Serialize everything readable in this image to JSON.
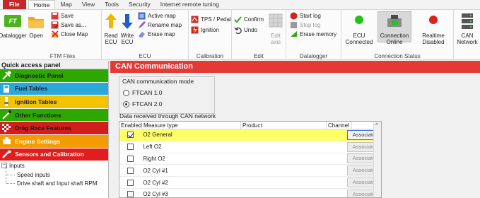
{
  "menu": {
    "tabs": [
      "File",
      "Home",
      "Map",
      "View",
      "Tools",
      "Security",
      "Internet remote tuning"
    ],
    "active": "Home"
  },
  "ribbon": {
    "groups": {
      "ftm_files": "FTM Files",
      "ecu": "ECU",
      "calibration": "Calibration",
      "edit": "Edit",
      "datalogger": "Datalogger",
      "connection_status": "Connection Status"
    },
    "datalogger": "Datalogger",
    "open": "Open",
    "save": "Save",
    "save_as": "Save as...",
    "close_map": "Close Map",
    "read_ecu": [
      "Read",
      "ECU"
    ],
    "write_ecu": [
      "Write",
      "ECU"
    ],
    "active_map": "Active map",
    "rename_map": "Rename map",
    "erase_map": "Erase map",
    "tps_pedal": "TPS / Pedal",
    "ignition": "Ignition",
    "confirm": "Confirm",
    "undo": "Undo",
    "edit_axis": [
      "Edit",
      "axis"
    ],
    "start_log": "Start log",
    "stop_log": "Stop log",
    "erase_memory": "Erase memory",
    "ecu_connected": [
      "ECU",
      "Connected"
    ],
    "connection_online": [
      "Connection",
      "Online"
    ],
    "realtime_disabled": [
      "Realtime",
      "Disabled"
    ],
    "can_network": [
      "CAN",
      "Network"
    ],
    "status_colors": {
      "ecu": "#22c41a",
      "connection": "#22c41a",
      "realtime": "#e02020"
    }
  },
  "quick_access": {
    "title": "Quick access panel",
    "panels": [
      {
        "label": "Diagnostic Panel",
        "color": "#2ea800",
        "icon": "diagnostic-icon"
      },
      {
        "label": "Fuel Tables",
        "color": "#29a8d9",
        "icon": "fuel-icon"
      },
      {
        "label": "Ignition Tables",
        "color": "#f3c300",
        "icon": "ignition-icon"
      },
      {
        "label": "Other Functions",
        "color": "#2ea800",
        "icon": "functions-icon"
      },
      {
        "label": "Drag Race Features",
        "color": "#d21d1d",
        "icon": "drag-race-icon"
      },
      {
        "label": "Engine Settings",
        "color": "#f39c00",
        "icon": "engine-icon"
      },
      {
        "label": "Sensors and Calibration",
        "color": "#e11d1d",
        "icon": "sensor-icon"
      }
    ],
    "tree": {
      "root": "Inputs",
      "children": [
        "Speed inputs",
        "Drive shaft and Input shaft RPM"
      ]
    }
  },
  "main": {
    "title": "CAN Communication",
    "mode": {
      "title": "CAN communication mode",
      "options": [
        "FTCAN 1.0",
        "FTCAN 2.0"
      ],
      "selected": "FTCAN 2.0"
    },
    "received": {
      "title": "Data received through CAN network",
      "columns": [
        "Enabled",
        "Measure type",
        "Product",
        "Channel"
      ],
      "rows": [
        {
          "enabled": true,
          "measure": "O2 General",
          "product": "",
          "channel": "",
          "action": "Associate"
        },
        {
          "enabled": false,
          "measure": "Left O2",
          "product": "",
          "channel": "",
          "action": "Associate"
        },
        {
          "enabled": false,
          "measure": "Right O2",
          "product": "",
          "channel": "",
          "action": "Associate"
        },
        {
          "enabled": false,
          "measure": "O2 Cyl #1",
          "product": "",
          "channel": "",
          "action": "Associate"
        },
        {
          "enabled": false,
          "measure": "O2 Cyl #2",
          "product": "",
          "channel": "",
          "action": "Associate"
        },
        {
          "enabled": false,
          "measure": "O2 Cyl #3",
          "product": "",
          "channel": "",
          "action": "Associate"
        }
      ]
    }
  }
}
